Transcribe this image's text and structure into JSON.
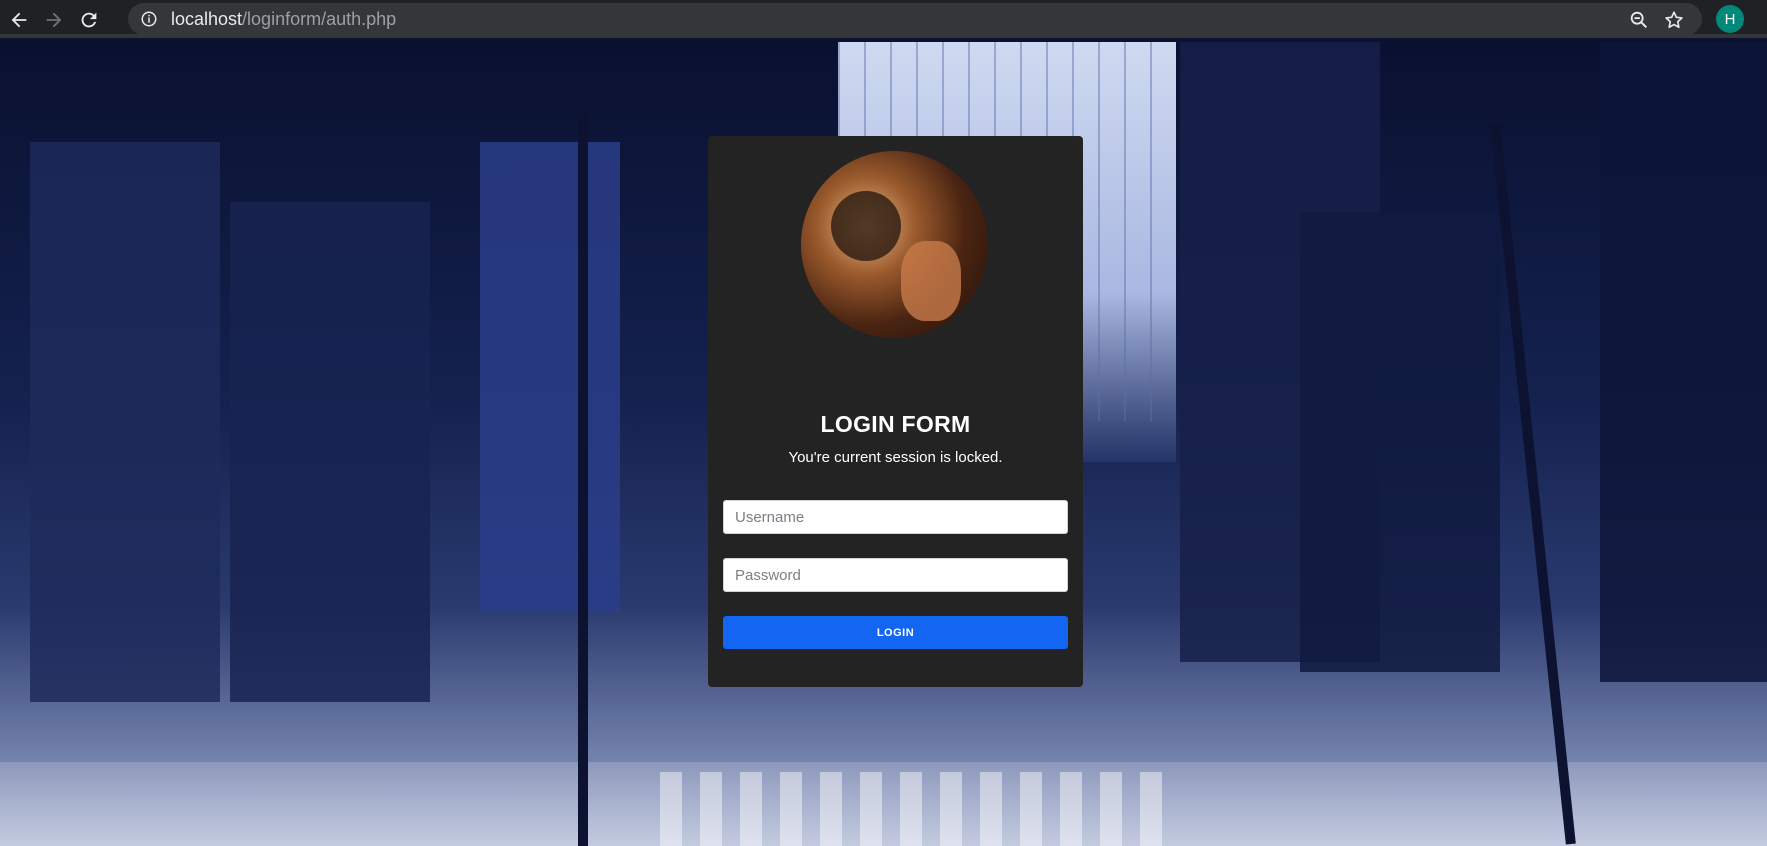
{
  "browser": {
    "url_host": "localhost",
    "url_path": "/loginform/auth.php",
    "profile_initial": "H",
    "icons": [
      "back-arrow-icon",
      "forward-arrow-icon",
      "reload-icon",
      "info-icon",
      "zoom-icon",
      "star-icon"
    ]
  },
  "login": {
    "title": "LOGIN FORM",
    "subtitle": "You're current session is locked.",
    "username_placeholder": "Username",
    "password_placeholder": "Password",
    "submit_label": "LOGIN"
  },
  "colors": {
    "card_bg": "#232323",
    "button_bg": "#1266f1",
    "avatar_bg": "#00897b"
  }
}
